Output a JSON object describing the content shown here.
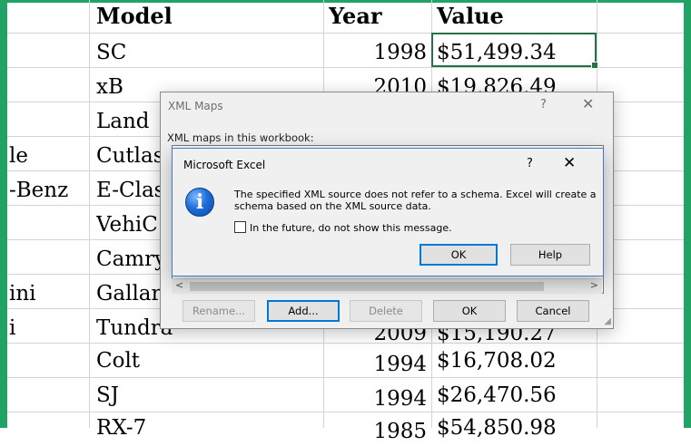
{
  "sheet": {
    "headers": {
      "model": "Model",
      "year": "Year",
      "value": "Value"
    },
    "rows": [
      {
        "make": "",
        "model": "SC",
        "year": "1998",
        "value": "$51,499.34"
      },
      {
        "make": "",
        "model": "xB",
        "year": "2010",
        "value": "$19,826.49"
      },
      {
        "make": "",
        "model": "Land",
        "year": "",
        "value": ""
      },
      {
        "make": "le",
        "model": "Cutlas",
        "year": "",
        "value": ""
      },
      {
        "make": "-Benz",
        "model": "E-Clas",
        "year": "",
        "value": ""
      },
      {
        "make": "",
        "model": "VehiC",
        "year": "",
        "value": ""
      },
      {
        "make": "",
        "model": "Camry",
        "year": "",
        "value": ""
      },
      {
        "make": "ini",
        "model": "Gallar",
        "year": "",
        "value": ""
      },
      {
        "make": "i",
        "model": "Tundra",
        "year": "2009",
        "value": "$15,190.27"
      },
      {
        "make": "",
        "model": "Colt",
        "year": "1994",
        "value": "$16,708.02"
      },
      {
        "make": "",
        "model": "SJ",
        "year": "1994",
        "value": "$26,470.56"
      },
      {
        "make": "",
        "model": "RX-7",
        "year": "1985",
        "value": "$54,850.98"
      }
    ]
  },
  "xml_maps": {
    "title": "XML Maps",
    "help": "?",
    "close": "✕",
    "maps_label": "XML maps in this workbook:",
    "scroll_left": "<",
    "scroll_right": ">",
    "buttons": {
      "rename": "Rename...",
      "add": "Add...",
      "delete": "Delete",
      "ok": "OK",
      "cancel": "Cancel"
    }
  },
  "message_box": {
    "title": "Microsoft Excel",
    "help": "?",
    "close": "✕",
    "icon": "information-icon",
    "icon_glyph": "i",
    "message": "The specified XML source does not refer to a schema. Excel will create a schema based on the XML source data.",
    "checkbox_label": "In the future, do not show this message.",
    "ok": "OK",
    "help_button": "Help"
  },
  "colors": {
    "accent": "#21a366",
    "dialog_border": "#3b7ac6",
    "default_button": "#0078d7"
  }
}
